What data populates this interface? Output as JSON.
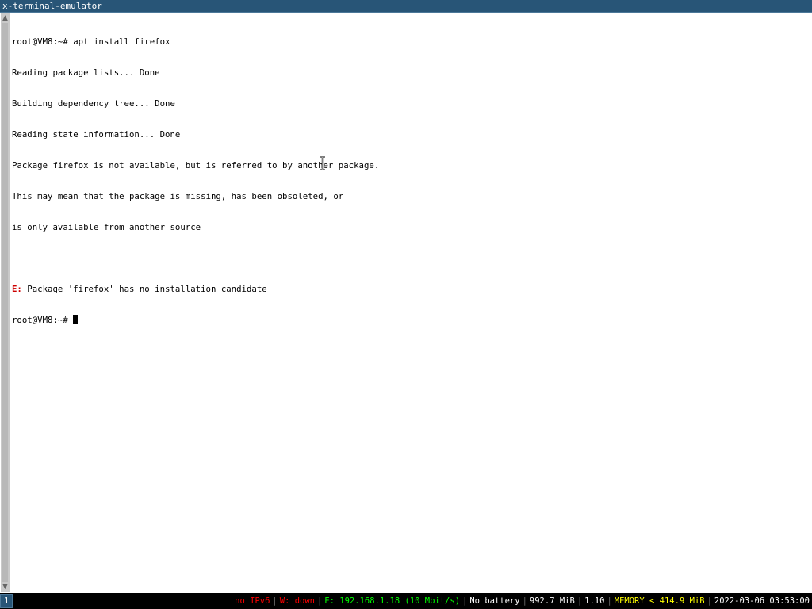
{
  "window": {
    "title": "x-terminal-emulator"
  },
  "terminal": {
    "lines": [
      "root@VM8:~# apt install firefox",
      "Reading package lists... Done",
      "Building dependency tree... Done",
      "Reading state information... Done",
      "Package firefox is not available, but is referred to by another package.",
      "This may mean that the package is missing, has been obsoleted, or",
      "is only available from another source",
      ""
    ],
    "error_prefix": "E:",
    "error_message": " Package 'firefox' has no installation candidate",
    "prompt": "root@VM8:~# "
  },
  "statusbar": {
    "workspace": "1",
    "ipv6": "no IPv6",
    "wireless": "W: down",
    "ethernet": "E: 192.168.1.18 (10 Mbit/s)",
    "battery": "No battery",
    "disk": "992.7 MiB",
    "load": "1.10",
    "memory": "MEMORY < 414.9 MiB",
    "datetime": "2022-03-06 03:53:00"
  },
  "colors": {
    "titlebar_bg": "#285577",
    "error_red": "#cd0000",
    "status_red": "#ff0000",
    "status_green": "#00ff00",
    "status_yellow": "#ffff00"
  },
  "icons": {
    "scroll_up": "scroll-up-arrow-icon",
    "scroll_down": "scroll-down-arrow-icon",
    "mouse_cursor": "text-ibeam-cursor-icon"
  }
}
